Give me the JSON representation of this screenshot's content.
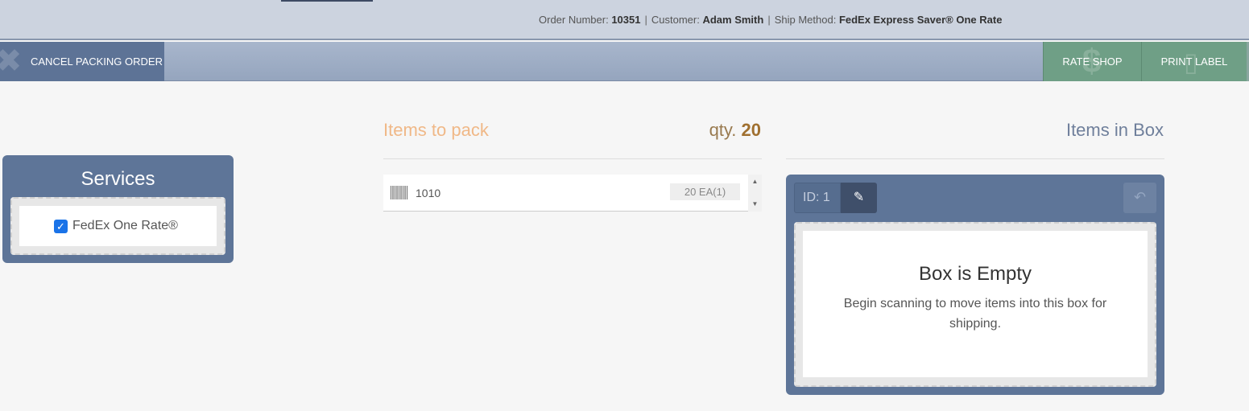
{
  "order_info": {
    "order_number_label": "Order Number:",
    "order_number": "10351",
    "customer_label": "Customer:",
    "customer": "Adam Smith",
    "ship_method_label": "Ship Method:",
    "ship_method": "FedEx Express Saver® One Rate",
    "separator": "|"
  },
  "actions": {
    "cancel_label": "CANCEL PACKING ORDER",
    "rate_shop_label": "RATE SHOP",
    "print_label_label": "PRINT LABEL"
  },
  "services": {
    "title": "Services",
    "items": [
      {
        "label": "FedEx One Rate®",
        "checked": true
      }
    ]
  },
  "pack": {
    "title": "Items to pack",
    "qty_label": "qty.",
    "qty": "20",
    "items": [
      {
        "sku": "1010",
        "quantity": "20 EA(1)"
      }
    ]
  },
  "box": {
    "title": "Items in Box",
    "id_label": "ID: 1",
    "empty_title": "Box is Empty",
    "empty_message": "Begin scanning to move items into this box for shipping."
  },
  "icons": {
    "cancel": "x-icon",
    "rate_shop": "dollar-icon",
    "print_label": "file-icon",
    "barcode": "barcode-icon",
    "edit": "edit-icon",
    "undo": "undo-icon"
  },
  "colors": {
    "panel_blue": "#5e7598",
    "action_green": "#6f9f86",
    "pack_title": "#f0b887",
    "qty": "#a07030",
    "checkbox": "#1a73e8"
  }
}
